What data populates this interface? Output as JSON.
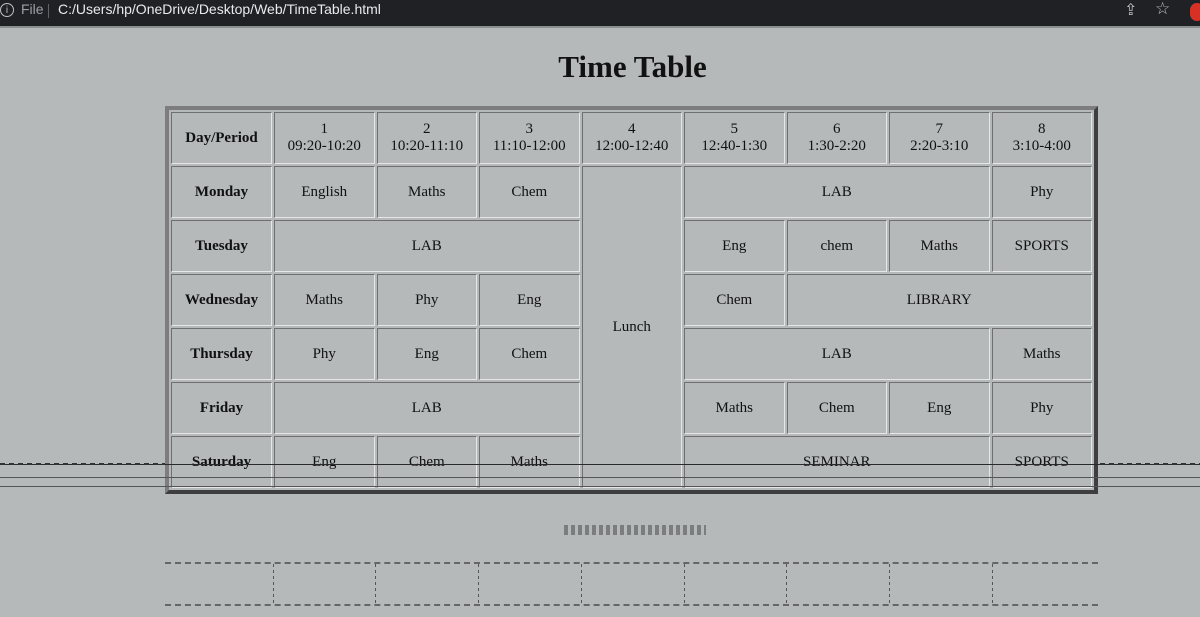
{
  "browser": {
    "file_label": "File",
    "url": "C:/Users/hp/OneDrive/Desktop/Web/TimeTable.html"
  },
  "page": {
    "title": "Time Table"
  },
  "table": {
    "header_label": "Day/Period",
    "periods": [
      {
        "num": "1",
        "time": "09:20-10:20"
      },
      {
        "num": "2",
        "time": "10:20-11:10"
      },
      {
        "num": "3",
        "time": "11:10-12:00"
      },
      {
        "num": "4",
        "time": "12:00-12:40"
      },
      {
        "num": "5",
        "time": "12:40-1:30"
      },
      {
        "num": "6",
        "time": "1:30-2:20"
      },
      {
        "num": "7",
        "time": "2:20-3:10"
      },
      {
        "num": "8",
        "time": "3:10-4:00"
      }
    ],
    "lunch_label": "Lunch",
    "rows": [
      {
        "day": "Monday",
        "cells": [
          {
            "text": "English",
            "span": 1
          },
          {
            "text": "Maths",
            "span": 1
          },
          {
            "text": "Chem",
            "span": 1
          },
          {
            "text": "LAB",
            "span": 3
          },
          {
            "text": "Phy",
            "span": 1
          }
        ]
      },
      {
        "day": "Tuesday",
        "cells": [
          {
            "text": "LAB",
            "span": 3
          },
          {
            "text": "Eng",
            "span": 1
          },
          {
            "text": "chem",
            "span": 1
          },
          {
            "text": "Maths",
            "span": 1
          },
          {
            "text": "SPORTS",
            "span": 1
          }
        ]
      },
      {
        "day": "Wednesday",
        "cells": [
          {
            "text": "Maths",
            "span": 1
          },
          {
            "text": "Phy",
            "span": 1
          },
          {
            "text": "Eng",
            "span": 1
          },
          {
            "text": "Chem",
            "span": 1
          },
          {
            "text": "LIBRARY",
            "span": 3
          }
        ]
      },
      {
        "day": "Thursday",
        "cells": [
          {
            "text": "Phy",
            "span": 1
          },
          {
            "text": "Eng",
            "span": 1
          },
          {
            "text": "Chem",
            "span": 1
          },
          {
            "text": "LAB",
            "span": 3
          },
          {
            "text": "Maths",
            "span": 1
          }
        ]
      },
      {
        "day": "Friday",
        "cells": [
          {
            "text": "LAB",
            "span": 3
          },
          {
            "text": "Maths",
            "span": 1
          },
          {
            "text": "Chem",
            "span": 1
          },
          {
            "text": "Eng",
            "span": 1
          },
          {
            "text": "Phy",
            "span": 1
          }
        ]
      },
      {
        "day": "Saturday",
        "cells": [
          {
            "text": "Eng",
            "span": 1
          },
          {
            "text": "Chem",
            "span": 1
          },
          {
            "text": "Maths",
            "span": 1
          },
          {
            "text": "SEMINAR",
            "span": 3
          },
          {
            "text": "SPORTS",
            "span": 1
          }
        ]
      }
    ]
  }
}
